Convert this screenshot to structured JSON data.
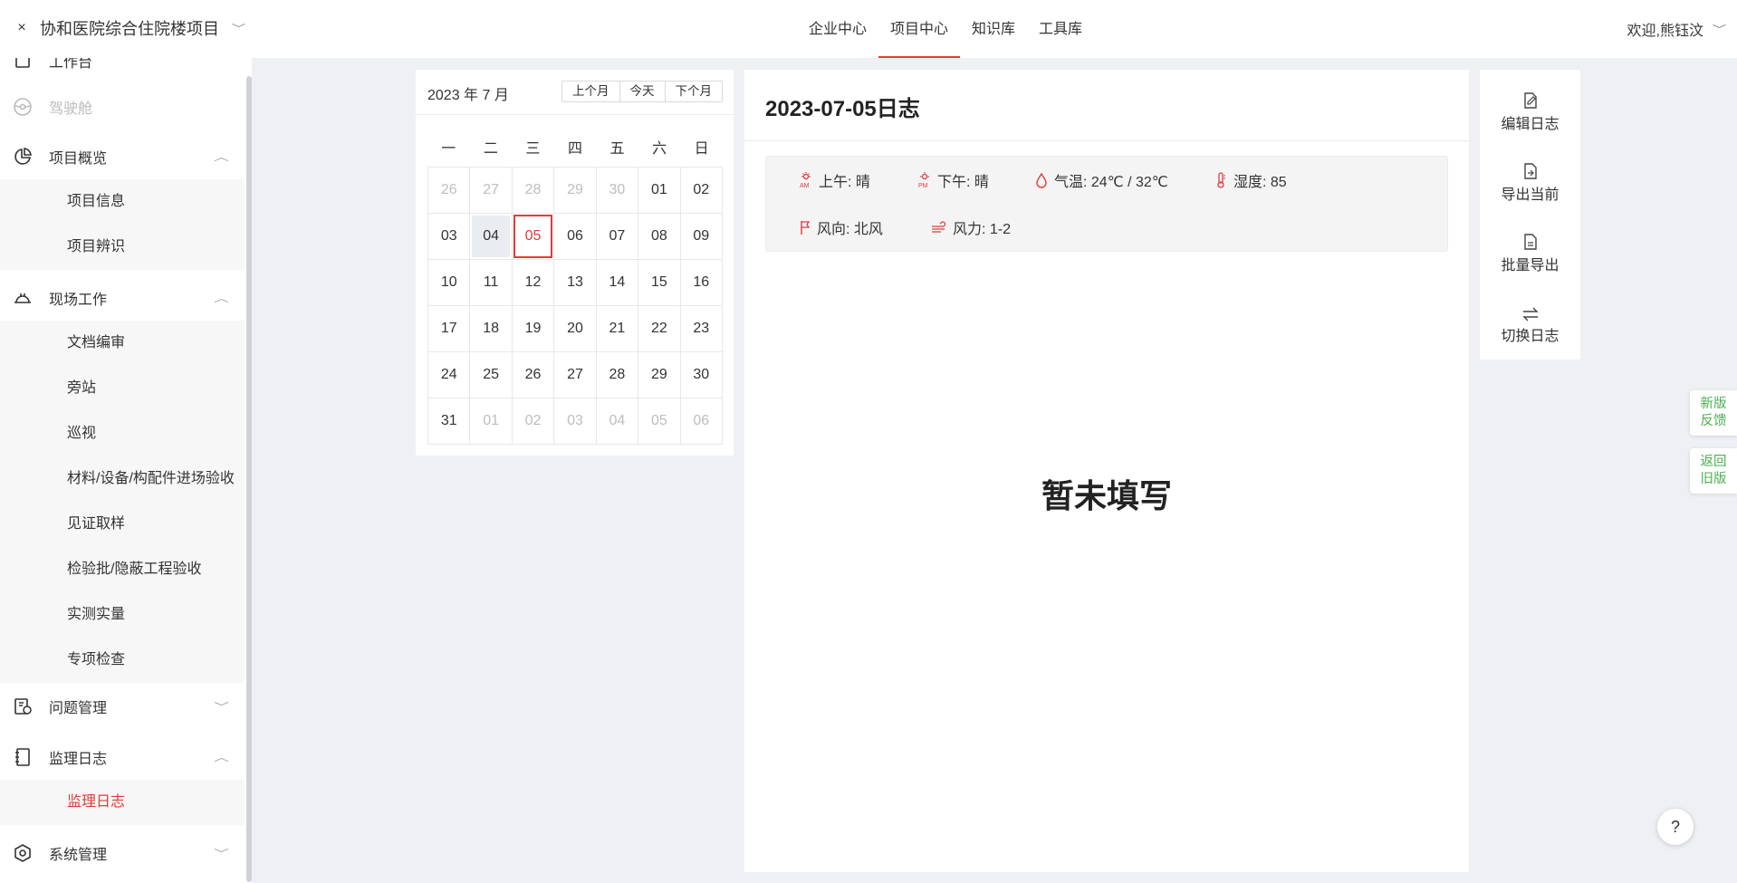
{
  "header": {
    "close_glyph": "×",
    "project_name": "协和医院综合住院楼项目",
    "tabs": [
      {
        "label": "企业中心",
        "active": false
      },
      {
        "label": "项目中心",
        "active": true
      },
      {
        "label": "知识库",
        "active": false
      },
      {
        "label": "工具库",
        "active": false
      }
    ],
    "welcome": "欢迎,熊钰汶"
  },
  "sidebar": {
    "clipped_item": "工作台",
    "cockpit": "驾驶舱",
    "groups": [
      {
        "label": "项目概览",
        "icon": "pie-chart-icon",
        "expanded": true,
        "items": [
          "项目信息",
          "项目辨识"
        ]
      },
      {
        "label": "现场工作",
        "icon": "helmet-icon",
        "expanded": true,
        "items": [
          "文档编审",
          "旁站",
          "巡视",
          "材料/设备/构配件进场验收",
          "见证取样",
          "检验批/隐蔽工程验收",
          "实测实量",
          "专项检查"
        ]
      },
      {
        "label": "问题管理",
        "icon": "clipboard-icon",
        "expanded": false,
        "items": []
      },
      {
        "label": "监理日志",
        "icon": "notebook-icon",
        "expanded": true,
        "items": [
          "监理日志"
        ],
        "active_item": "监理日志"
      },
      {
        "label": "系统管理",
        "icon": "settings-icon",
        "expanded": false,
        "items": []
      }
    ]
  },
  "calendar": {
    "title": "2023 年 7 月",
    "buttons": {
      "prev": "上个月",
      "today": "今天",
      "next": "下个月"
    },
    "weekdays": [
      "一",
      "二",
      "三",
      "四",
      "五",
      "六",
      "日"
    ],
    "days": [
      {
        "label": "26",
        "other": true
      },
      {
        "label": "27",
        "other": true
      },
      {
        "label": "28",
        "other": true
      },
      {
        "label": "29",
        "other": true
      },
      {
        "label": "30",
        "other": true
      },
      {
        "label": "01"
      },
      {
        "label": "02"
      },
      {
        "label": "03"
      },
      {
        "label": "04",
        "today": true
      },
      {
        "label": "05",
        "selected": true
      },
      {
        "label": "06"
      },
      {
        "label": "07"
      },
      {
        "label": "08"
      },
      {
        "label": "09"
      },
      {
        "label": "10"
      },
      {
        "label": "11"
      },
      {
        "label": "12"
      },
      {
        "label": "13"
      },
      {
        "label": "14"
      },
      {
        "label": "15"
      },
      {
        "label": "16"
      },
      {
        "label": "17"
      },
      {
        "label": "18"
      },
      {
        "label": "19"
      },
      {
        "label": "20"
      },
      {
        "label": "21"
      },
      {
        "label": "22"
      },
      {
        "label": "23"
      },
      {
        "label": "24"
      },
      {
        "label": "25"
      },
      {
        "label": "26"
      },
      {
        "label": "27"
      },
      {
        "label": "28"
      },
      {
        "label": "29"
      },
      {
        "label": "30"
      },
      {
        "label": "31"
      },
      {
        "label": "01",
        "other": true
      },
      {
        "label": "02",
        "other": true
      },
      {
        "label": "03",
        "other": true
      },
      {
        "label": "04",
        "other": true
      },
      {
        "label": "05",
        "other": true
      },
      {
        "label": "06",
        "other": true
      }
    ]
  },
  "log": {
    "title": "2023-07-05日志",
    "weather": {
      "am": "上午: 晴",
      "pm": "下午: 晴",
      "temp": "气温: 24℃ / 32℃",
      "humidity": "湿度: 85",
      "wind_dir": "风向: 北风",
      "wind_force": "风力: 1-2",
      "am_glyph": "AM",
      "pm_glyph": "PM"
    },
    "empty_text": "暂未填写"
  },
  "actions": [
    {
      "label": "编辑日志",
      "icon": "edit-doc-icon"
    },
    {
      "label": "导出当前",
      "icon": "export-doc-icon"
    },
    {
      "label": "批量导出",
      "icon": "batch-export-icon"
    },
    {
      "label": "切换日志",
      "icon": "switch-icon"
    }
  ],
  "floating": {
    "feedback_line1": "新版",
    "feedback_line2": "反馈",
    "old_line1": "返回",
    "old_line2": "旧版",
    "help": "?"
  },
  "colors": {
    "accent": "#e23a3a",
    "float_green": "#4caf50"
  }
}
